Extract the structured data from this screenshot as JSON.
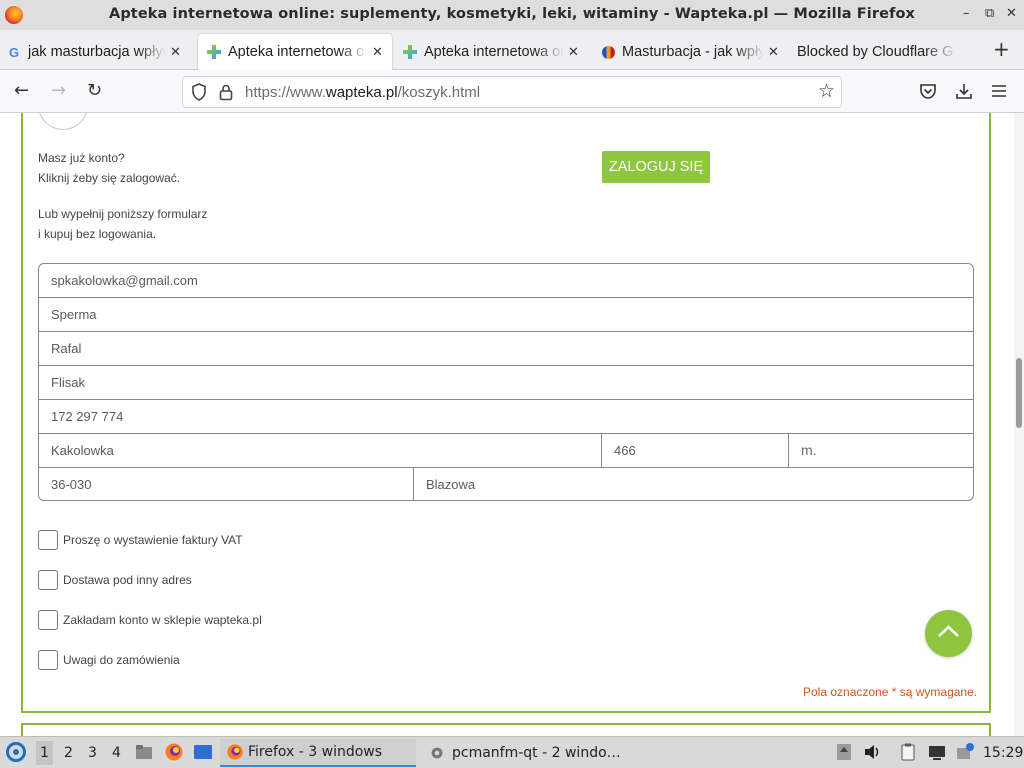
{
  "window": {
    "title": "Apteka internetowa online: suplementy, kosmetyki, leki, witaminy - Wapteka.pl — Mozilla Firefox",
    "controls": {
      "minimize": "–",
      "maximize": "⧉",
      "close": "✕"
    }
  },
  "tabs": [
    {
      "label": "jak masturbacja wpływa",
      "icon": "google-icon",
      "active": false
    },
    {
      "label": "Apteka internetowa onl",
      "icon": "wapteka-icon",
      "active": true
    },
    {
      "label": "Apteka internetowa onl",
      "icon": "wapteka-icon",
      "active": false
    },
    {
      "label": "Masturbacja - jak wpły",
      "icon": "site-icon",
      "active": false
    },
    {
      "label": "Blocked by Cloudflare G",
      "icon": "none",
      "active": false
    }
  ],
  "tab_close": "✕",
  "newtab": "+",
  "nav": {
    "back": "←",
    "forward": "→",
    "reload": "↻",
    "url_prefix": "https://www.",
    "url_domain": "wapteka.pl",
    "url_path": "/koszyk.html",
    "bookmark": "☆"
  },
  "toolbar_icons": [
    "pocket-icon",
    "downloads-icon",
    "menu-icon"
  ],
  "page": {
    "account_prompt_line1": "Masz już konto?",
    "account_prompt_line2": "Kliknij żeby się zalogować.",
    "login_button": "ZALOGUJ SIĘ",
    "guest_line1": "Lub wypełnij poniższy formularz",
    "guest_line2": "i kupuj bez logowania.",
    "form": {
      "email": "spkakolowka@gmail.com",
      "company": "Sperma",
      "first_name": "Rafal",
      "last_name": "Flisak",
      "phone": "172 297 774",
      "street": "Kakolowka",
      "house_number": "466",
      "apartment_placeholder": "m.",
      "postal_code": "36-030",
      "city": "Blazowa"
    },
    "checkboxes": [
      {
        "label": "Proszę o wystawienie faktury VAT",
        "checked": false
      },
      {
        "label": "Dostawa pod inny adres",
        "checked": false
      },
      {
        "label": "Zakładam konto w sklepie wapteka.pl",
        "checked": false
      },
      {
        "label": "Uwagi do zamówienia",
        "checked": false
      }
    ],
    "required_note": "Pola oznaczone * są wymagane.",
    "accent_color": "#8ec63f",
    "required_color": "#d0551c"
  },
  "taskbar": {
    "workspaces": [
      "1",
      "2",
      "3",
      "4"
    ],
    "active_workspace": "1",
    "tasks": [
      {
        "label": "Firefox - 3 windows",
        "icon": "firefox-icon",
        "active": true
      },
      {
        "label": "pcmanfm-qt - 2 windo…",
        "icon": "gear-icon",
        "active": false
      }
    ],
    "clock": "15:29"
  }
}
